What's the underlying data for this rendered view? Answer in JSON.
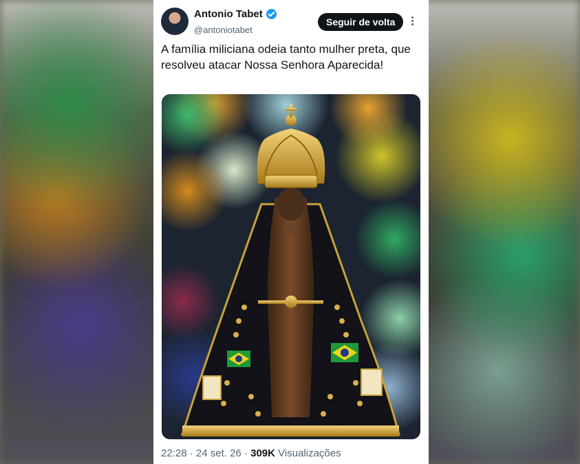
{
  "tweet": {
    "author_name": "Antonio Tabet",
    "handle": "@antoniotabet",
    "follow_label": "Seguir de volta",
    "text": "A família miliciana odeia tanto mulher preta, que resolveu atacar Nossa Senhora Aparecida!",
    "time": "22:28",
    "date": "24 set. 26",
    "views_count": "309K",
    "views_label": "Visualizações",
    "separator": "·"
  },
  "colors": {
    "verified": "#1d9bf0",
    "text_primary": "#0f1419",
    "text_secondary": "#536471",
    "follow_bg": "#0f1419"
  },
  "icons": {
    "verified": "verified-badge-icon",
    "more": "more-vertical-icon"
  }
}
